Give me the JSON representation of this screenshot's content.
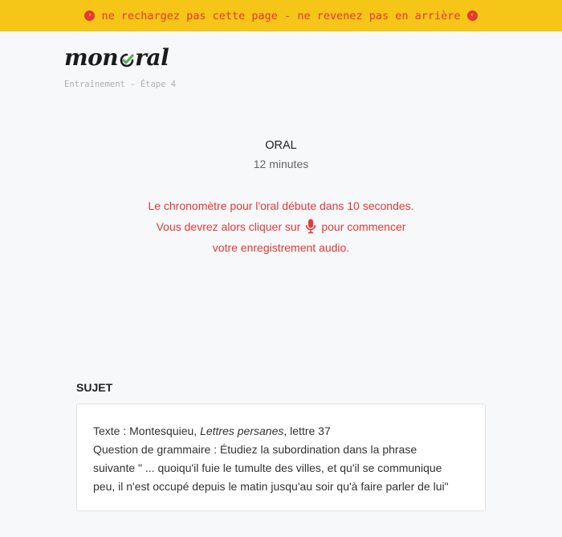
{
  "banner": {
    "left_icon": "chevron-right-circle-icon",
    "right_icon": "chevron-left-circle-icon",
    "text": "ne rechargez pas cette page - ne revenez pas en arrière"
  },
  "logo": {
    "part1": "mon ",
    "part2": "ral",
    "check_color": "#4caf50"
  },
  "subtitle": "Entraînement - Étape 4",
  "oral": {
    "title": "ORAL",
    "duration": "12 minutes"
  },
  "notice": {
    "line1": "Le chronomètre pour l'oral débute dans 10 secondes.",
    "line2_before": "Vous devrez alors cliquer sur",
    "line2_after": "pour commencer",
    "line3": "votre enregistrement audio.",
    "icon": "microphone-icon",
    "color": "#e53935"
  },
  "sujet": {
    "label": "SUJET",
    "texte_prefix": "Texte : Montesquieu, ",
    "texte_title": "Lettres persanes",
    "texte_suffix": ", lettre 37",
    "question_line1": "Question de grammaire : Étudiez la subordination dans la phrase",
    "question_line2": "suivante \" ... quoiqu'il fuie le tumulte des villes, et qu'il se communique",
    "question_line3": "peu, il n'est occupé depuis le matin jusqu'au soir qu'à faire parler de lui\""
  },
  "colors": {
    "banner_bg": "#f5c518",
    "accent_red": "#e53935",
    "page_bg": "#f7f8fa"
  }
}
